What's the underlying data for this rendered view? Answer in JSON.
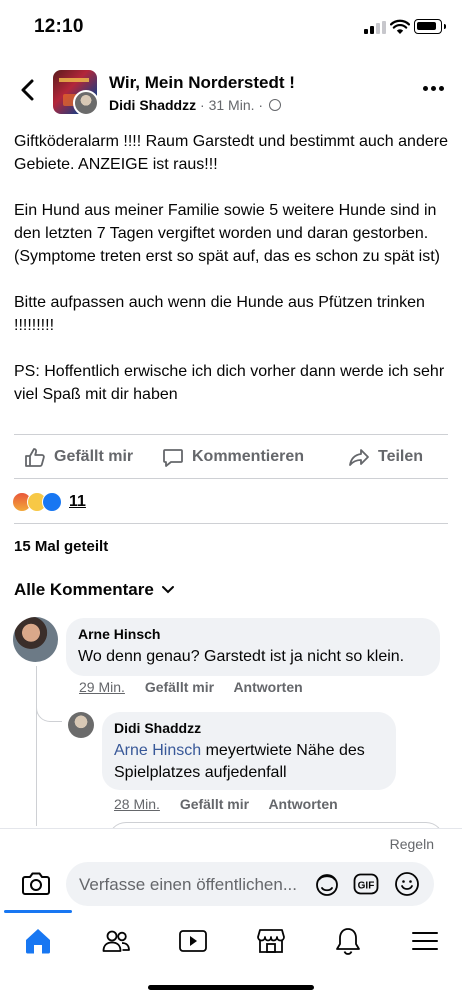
{
  "status_bar": {
    "time": "12:10"
  },
  "header": {
    "group_name": "Wir, Mein Norderstedt !",
    "author": "Didi Shaddzz",
    "time_ago": "31 Min.",
    "separator": "·"
  },
  "post": {
    "paragraphs": [
      "Giftköderalarm !!!! Raum Garstedt und bestimmt auch andere Gebiete. ANZEIGE ist raus!!!",
      "Ein Hund aus meiner Familie sowie 5 weitere Hunde sind in den letzten 7 Tagen vergiftet worden und daran gestorben. (Symptome treten erst so spät auf, das es schon zu spät ist)",
      "Bitte aufpassen auch wenn die Hunde aus Pfützen trinken !!!!!!!!!",
      "PS: Hoffentlich erwische ich dich vorher dann werde ich sehr viel Spaß mit dir haben"
    ]
  },
  "actions": {
    "like": "Gefällt mir",
    "comment": "Kommentieren",
    "share": "Teilen"
  },
  "reactions": {
    "count": "11",
    "types": [
      "angry",
      "sad",
      "like"
    ]
  },
  "shares_text": "15 Mal geteilt",
  "comments": {
    "filter_label": "Alle Kommentare",
    "items": [
      {
        "author": "Arne Hinsch",
        "text": "Wo denn genau? Garstedt ist ja nicht so klein.",
        "time": "29 Min.",
        "like": "Gefällt mir",
        "reply": "Antworten"
      },
      {
        "author": "Didi Shaddzz",
        "mention": "Arne Hinsch",
        "text": " meyertwiete Nähe des Spielplatzes aufjedenfall",
        "time": "28 Min.",
        "like": "Gefällt mir",
        "reply": "Antworten"
      }
    ]
  },
  "composer": {
    "rules_label": "Regeln",
    "placeholder": "Verfasse einen öffentlichen...",
    "gif_label": "GIF"
  },
  "tabbar": {
    "tabs": [
      "home-icon",
      "friends-icon",
      "video-icon",
      "marketplace-icon",
      "notifications-icon",
      "menu-icon"
    ],
    "active": "home-icon"
  },
  "colors": {
    "accent": "#1877f2",
    "secondary_text": "#65676b",
    "bubble": "#f0f2f5",
    "mention": "#385898"
  }
}
